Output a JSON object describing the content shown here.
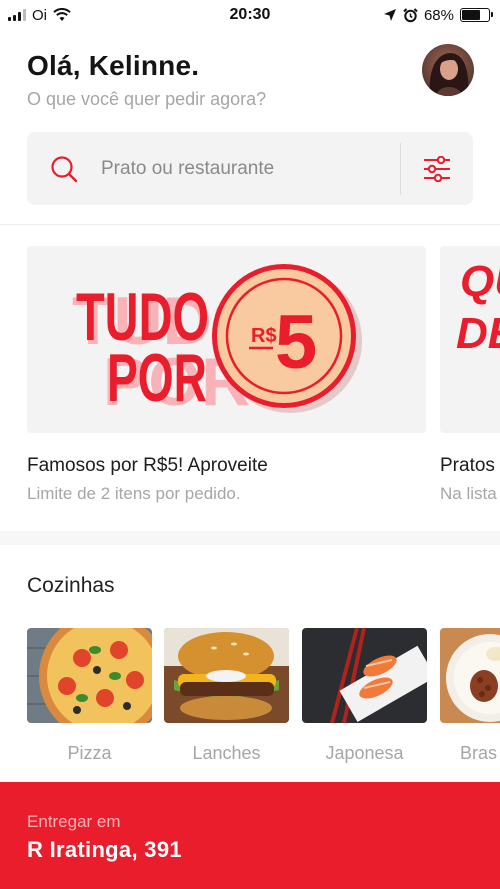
{
  "status_bar": {
    "carrier": "Oi",
    "time": "20:30",
    "battery_percent": "68%",
    "battery_level": 0.68
  },
  "header": {
    "greeting": "Olá, Kelinne.",
    "subtitle": "O que você quer pedir agora?"
  },
  "search": {
    "placeholder": "Prato ou restaurante"
  },
  "promos": [
    {
      "art_lines": [
        "TUDO",
        "POR"
      ],
      "coin_currency": "R$",
      "coin_value": "5",
      "title": "Famosos por R$5! Aproveite",
      "subtitle": "Limite de 2 itens por pedido."
    },
    {
      "art_lines": [
        "QU",
        "DE"
      ],
      "title": "Pratos",
      "subtitle": "Na lista"
    }
  ],
  "cuisines": {
    "title": "Cozinhas",
    "items": [
      {
        "label": "Pizza"
      },
      {
        "label": "Lanches"
      },
      {
        "label": "Japonesa"
      },
      {
        "label": "Bras"
      }
    ]
  },
  "delivery": {
    "label": "Entregar em",
    "address": "R Iratinga, 391"
  },
  "colors": {
    "brand_red": "#ea1d2c",
    "coin": "#f9c9a0",
    "text_muted": "#a6a6a6"
  },
  "icons": [
    "signal-icon",
    "wifi-icon",
    "location-arrow-icon",
    "alarm-icon",
    "battery-icon",
    "search-icon",
    "filter-icon"
  ]
}
